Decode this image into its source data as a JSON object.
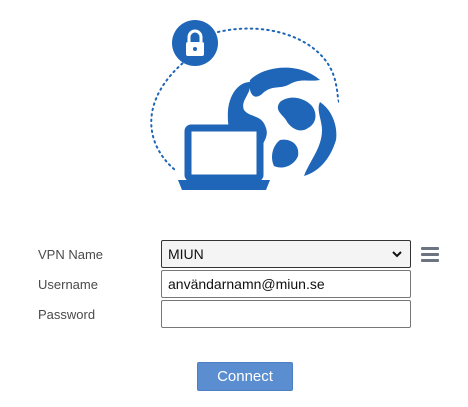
{
  "illustration": {
    "icons": [
      "lock-icon",
      "globe-icon",
      "laptop-icon"
    ],
    "accent_color": "#1f66b8"
  },
  "form": {
    "vpn_name": {
      "label": "VPN Name",
      "value": "MIUN"
    },
    "username": {
      "label": "Username",
      "value": "användarnamn@miun.se"
    },
    "password": {
      "label": "Password",
      "value": ""
    }
  },
  "menu": {
    "icon": "hamburger-menu-icon"
  },
  "actions": {
    "connect_label": "Connect",
    "connect_color": "#5b8ed1"
  }
}
